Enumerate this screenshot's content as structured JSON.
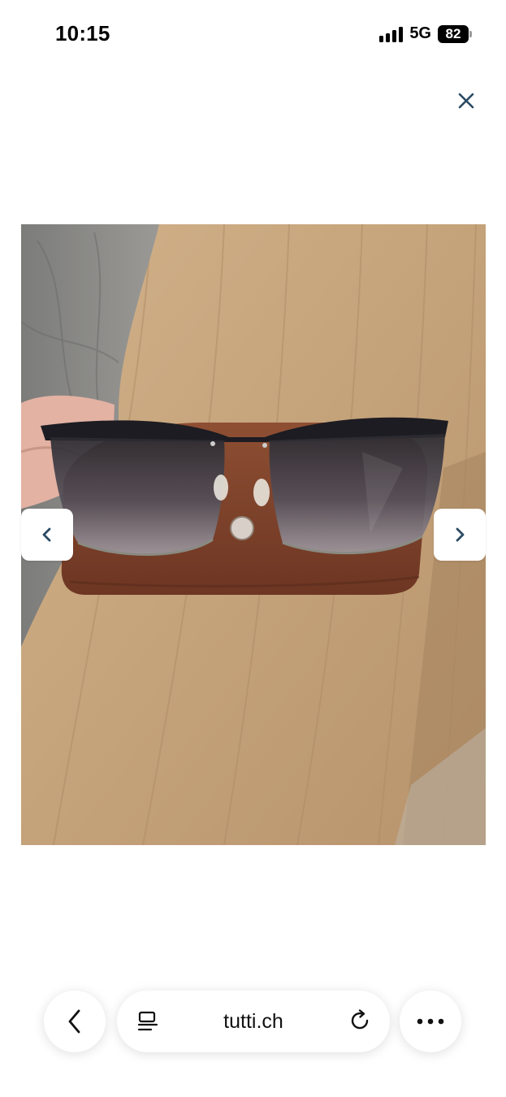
{
  "status_bar": {
    "time": "10:15",
    "network": "5G",
    "battery": "82"
  },
  "icons": {
    "close": "close-icon",
    "prev": "chevron-left-icon",
    "next": "chevron-right-icon",
    "back": "back-icon",
    "reader": "reader-mode-icon",
    "reload": "reload-icon",
    "more": "more-icon"
  },
  "browser_bar": {
    "url": "tutti.ch"
  },
  "colors": {
    "background": "#ffffff",
    "arrow_icon": "#2b4a63",
    "case_leather": "#8a4a30",
    "wood_table": "#c9a982"
  }
}
